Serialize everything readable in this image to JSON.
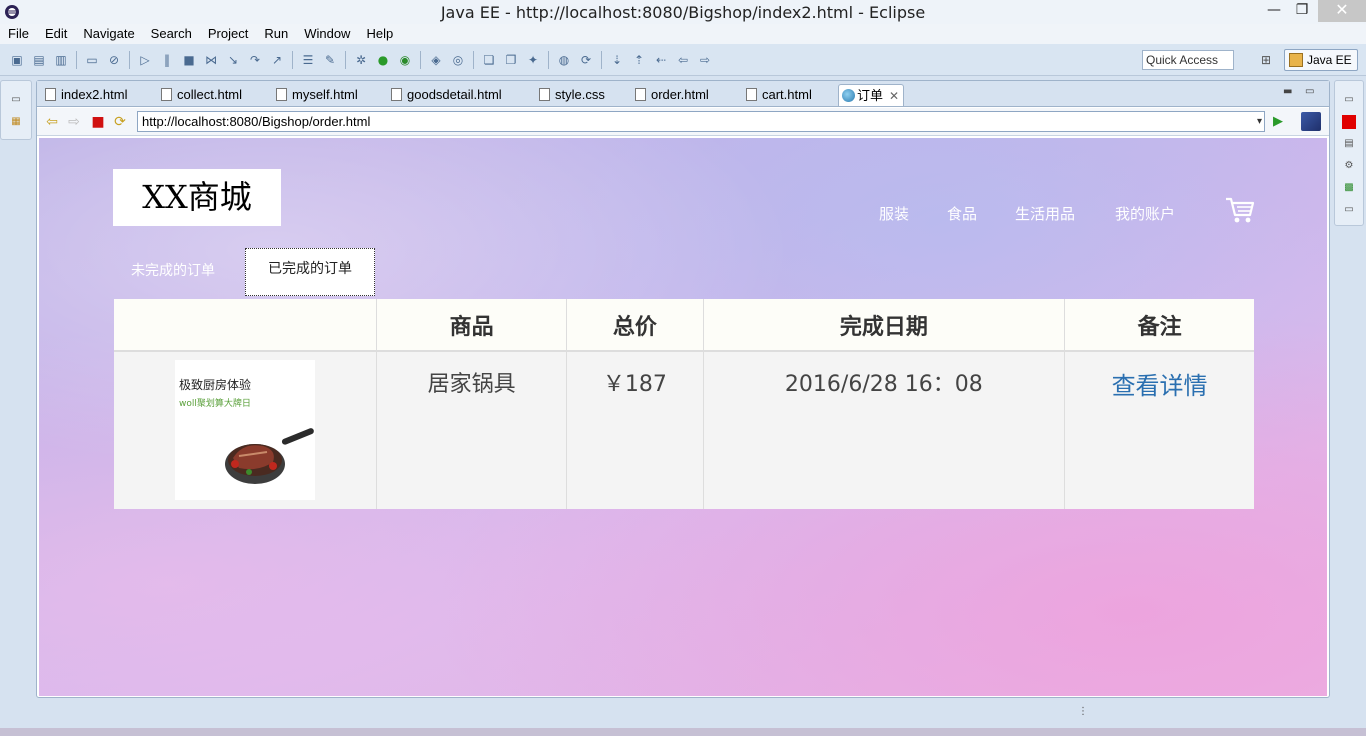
{
  "window": {
    "title": "Java EE - http://localhost:8080/Bigshop/index2.html - Eclipse",
    "min": "—",
    "max": "❐",
    "close": "✕"
  },
  "menu": [
    "File",
    "Edit",
    "Navigate",
    "Search",
    "Project",
    "Run",
    "Window",
    "Help"
  ],
  "toolbar": {
    "quick_access": "Quick Access",
    "perspective": "Java EE"
  },
  "tabs": [
    {
      "label": "index2.html"
    },
    {
      "label": "collect.html"
    },
    {
      "label": "myself.html"
    },
    {
      "label": "goodsdetail.html"
    },
    {
      "label": "style.css"
    },
    {
      "label": "order.html"
    },
    {
      "label": "cart.html"
    },
    {
      "label": "订单",
      "active": true
    }
  ],
  "browser": {
    "url": "http://localhost:8080/Bigshop/order.html"
  },
  "page": {
    "logo": "XX商城",
    "nav": [
      "服装",
      "食品",
      "生活用品",
      "我的账户"
    ],
    "order_tabs": {
      "pending": "未完成的订单",
      "completed": "已完成的订单"
    },
    "table": {
      "headers": [
        "",
        "商品",
        "总价",
        "完成日期",
        "备注"
      ],
      "rows": [
        {
          "image_title": "极致厨房体验",
          "image_subtitle": "woll聚划算大牌日",
          "product": "居家锅具",
          "price": "￥187",
          "date": "2016/6/28 16：08",
          "action": "查看详情"
        }
      ]
    }
  }
}
